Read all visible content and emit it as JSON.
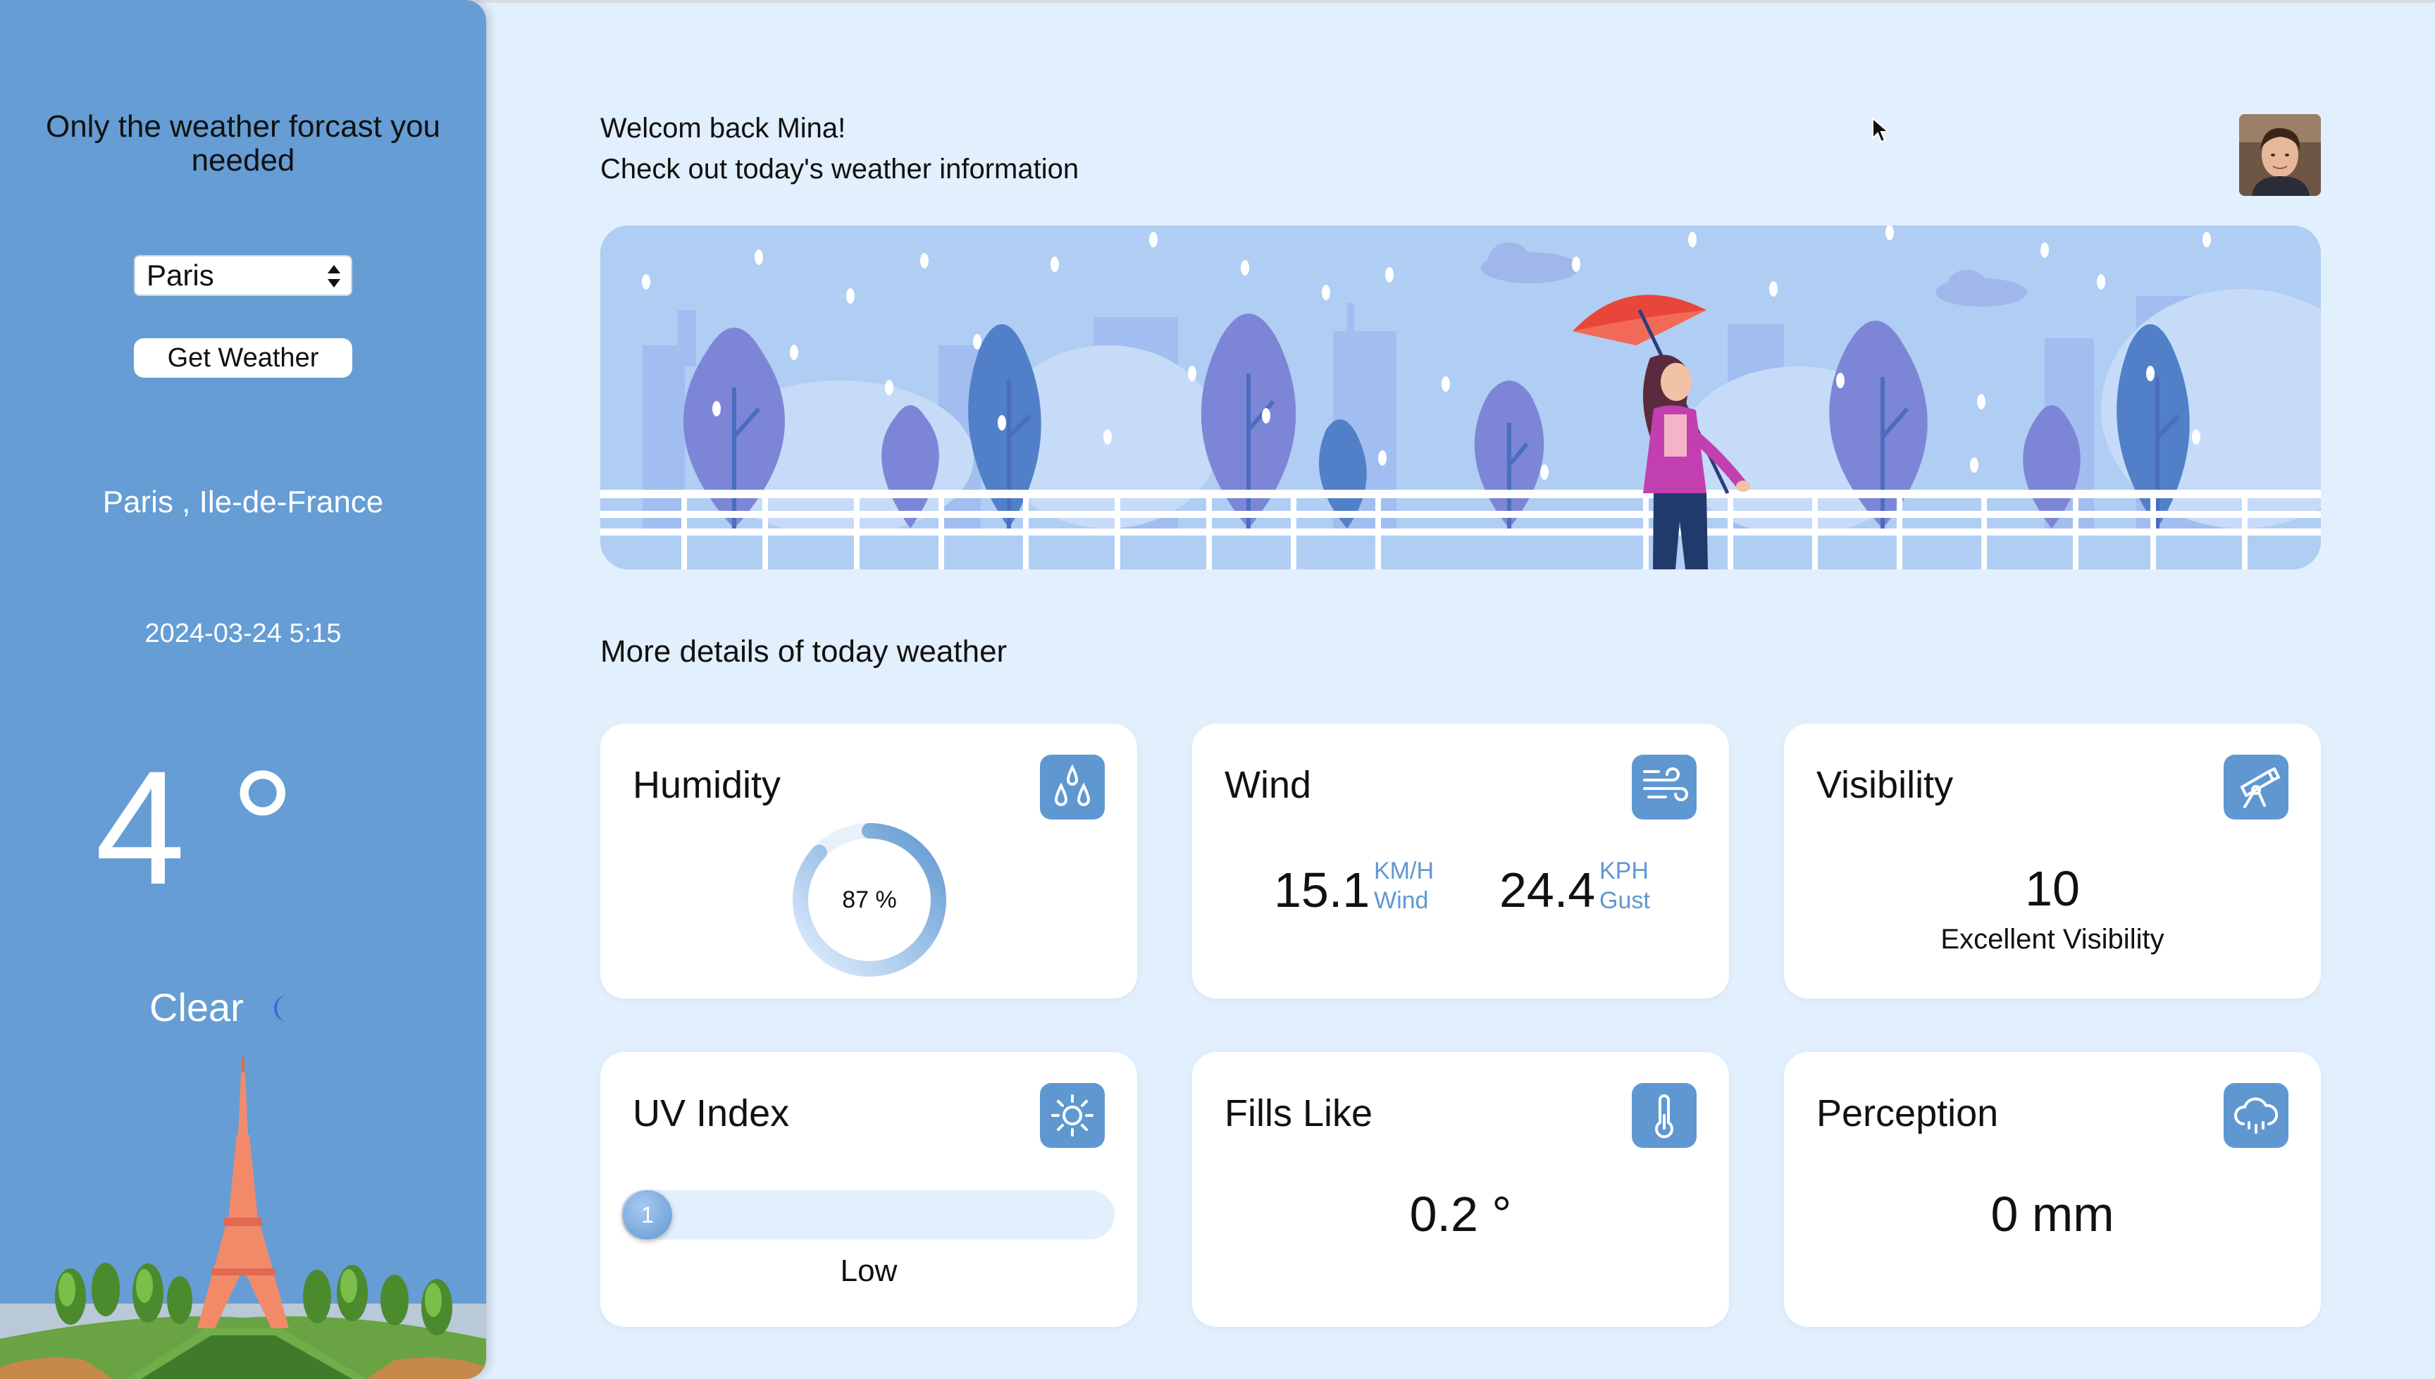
{
  "sidebar": {
    "tagline": "Only the weather forcast you needed",
    "city_select": {
      "value": "Paris",
      "options": [
        "Paris"
      ]
    },
    "get_weather_label": "Get Weather",
    "location": "Paris ,  Ile-de-France",
    "datetime": "2024-03-24 5:15",
    "temperature": "4 °",
    "condition": "Clear",
    "condition_icon": "crescent-moon-icon"
  },
  "header": {
    "greeting": "Welcom back Mina!",
    "subtitle": "Check out today's weather information",
    "avatar": "user-avatar"
  },
  "section_title": "More details of today weather",
  "cards": {
    "humidity": {
      "title": "Humidity",
      "icon": "water-drops-icon",
      "value_label": "87 %",
      "value": 87
    },
    "wind": {
      "title": "Wind",
      "icon": "wind-icon",
      "wind_value": "15.1",
      "wind_unit": "KM/H",
      "wind_label": "Wind",
      "gust_value": "24.4",
      "gust_unit": "KPH",
      "gust_label": "Gust"
    },
    "visibility": {
      "title": "Visibility",
      "icon": "telescope-icon",
      "value": "10",
      "label": "Excellent Visibility"
    },
    "uv": {
      "title": "UV Index",
      "icon": "sun-icon",
      "value": "1",
      "label": "Low",
      "level_fraction": 0.09
    },
    "feels_like": {
      "title": "Fills Like",
      "icon": "thermometer-icon",
      "value": "0.2 °"
    },
    "precipitation": {
      "title": "Perception",
      "icon": "rain-cloud-icon",
      "value": "0 mm"
    }
  },
  "colors": {
    "background": "#e2effd",
    "sidebar": "#659dd4",
    "accent": "#5f98d1",
    "card": "#ffffff"
  }
}
